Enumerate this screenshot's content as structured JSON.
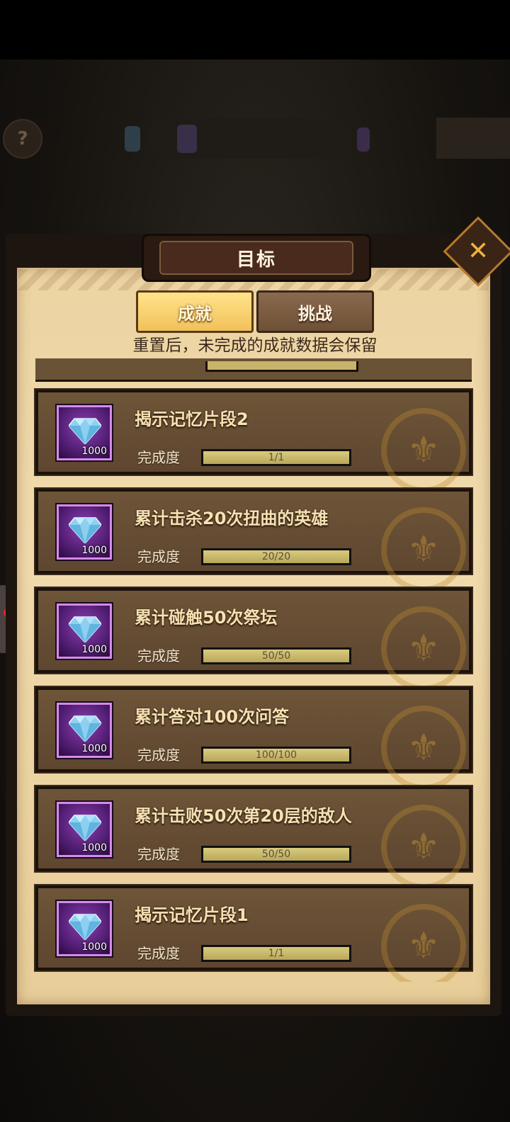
{
  "dialog": {
    "title": "目标",
    "close_glyph": "✕",
    "tabs": [
      {
        "label": "成就",
        "active": true
      },
      {
        "label": "挑战",
        "active": false
      }
    ],
    "notice": "重置后，未完成的成就数据会保留"
  },
  "achievements": [
    {
      "title": "揭示记忆片段2",
      "progress_label": "完成度",
      "progress_text": "1/1",
      "progress_fraction": 1.0,
      "reward_icon": "diamond-icon",
      "reward_count": "1000"
    },
    {
      "title": "累计击杀20次扭曲的英雄",
      "progress_label": "完成度",
      "progress_text": "20/20",
      "progress_fraction": 1.0,
      "reward_icon": "diamond-icon",
      "reward_count": "1000"
    },
    {
      "title": "累计碰触50次祭坛",
      "progress_label": "完成度",
      "progress_text": "50/50",
      "progress_fraction": 1.0,
      "reward_icon": "diamond-icon",
      "reward_count": "1000"
    },
    {
      "title": "累计答对100次问答",
      "progress_label": "完成度",
      "progress_text": "100/100",
      "progress_fraction": 1.0,
      "reward_icon": "diamond-icon",
      "reward_count": "1000"
    },
    {
      "title": "累计击败50次第20层的敌人",
      "progress_label": "完成度",
      "progress_text": "50/50",
      "progress_fraction": 1.0,
      "reward_icon": "diamond-icon",
      "reward_count": "1000"
    },
    {
      "title": "揭示记忆片段1",
      "progress_label": "完成度",
      "progress_text": "1/1",
      "progress_fraction": 1.0,
      "reward_icon": "diamond-icon",
      "reward_count": "1000"
    }
  ],
  "colors": {
    "paper": "#f0daac",
    "card": "#6e5538",
    "tab_active": "#f1c15a",
    "reward_frame": "#8e3fb4",
    "progress_fill": "#d9cb7e"
  }
}
